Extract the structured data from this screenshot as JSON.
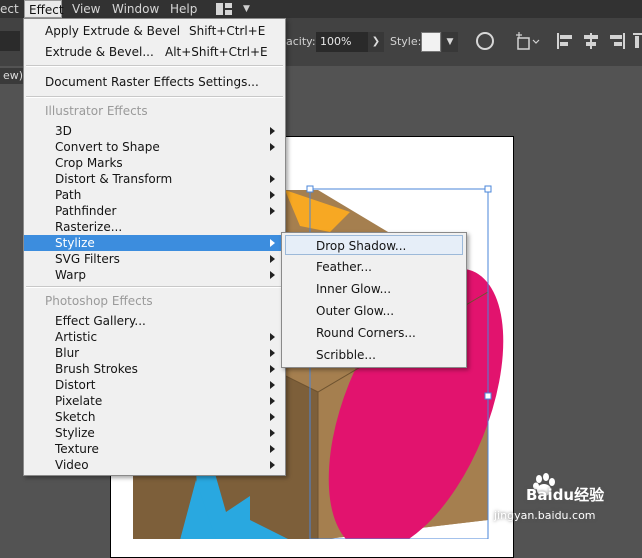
{
  "menubar": {
    "select_label": "ect",
    "effect_label": "Effect",
    "view_label": "View",
    "window_label": "Window",
    "help_label": "Help",
    "workspace_icon": "workspace-grid-icon"
  },
  "controlbar": {
    "opacity_label": "acity:",
    "opacity_value": "100%",
    "style_label": "Style:",
    "document_tab_label": "ew)"
  },
  "effect_menu": {
    "top_items": [
      {
        "label": "Apply Extrude & Bevel",
        "shortcut": "Shift+Ctrl+E"
      },
      {
        "label": "Extrude & Bevel...",
        "shortcut": "Alt+Shift+Ctrl+E"
      }
    ],
    "raster_settings": "Document Raster Effects Settings...",
    "illustrator_header": "Illustrator Effects",
    "illustrator_items": [
      {
        "label": "3D"
      },
      {
        "label": "Convert to Shape"
      },
      {
        "label": "Crop Marks"
      },
      {
        "label": "Distort & Transform"
      },
      {
        "label": "Path"
      },
      {
        "label": "Pathfinder"
      },
      {
        "label": "Rasterize..."
      },
      {
        "label": "Stylize"
      },
      {
        "label": "SVG Filters"
      },
      {
        "label": "Warp"
      }
    ],
    "photoshop_header": "Photoshop Effects",
    "photoshop_items": [
      {
        "label": "Effect Gallery..."
      },
      {
        "label": "Artistic"
      },
      {
        "label": "Blur"
      },
      {
        "label": "Brush Strokes"
      },
      {
        "label": "Distort"
      },
      {
        "label": "Pixelate"
      },
      {
        "label": "Sketch"
      },
      {
        "label": "Stylize"
      },
      {
        "label": "Texture"
      },
      {
        "label": "Video"
      }
    ]
  },
  "stylize_menu": {
    "items": [
      {
        "label": "Drop Shadow..."
      },
      {
        "label": "Feather..."
      },
      {
        "label": "Inner Glow..."
      },
      {
        "label": "Outer Glow..."
      },
      {
        "label": "Round Corners..."
      },
      {
        "label": "Scribble..."
      }
    ]
  },
  "watermark": {
    "brand": "Baidu",
    "brand_suffix": "经验",
    "url": "jingyan.baidu.com"
  },
  "colors": {
    "menubar_bg": "#323232",
    "control_bg": "#424242",
    "canvas_bg": "#535353",
    "menu_bg": "#f0f0f0",
    "highlight": "#3c8dde",
    "cube_light": "#a57f4f",
    "cube_dark": "#7d5f3a",
    "magenta": "#e2136e",
    "blue": "#29a8e0",
    "orange": "#f7a823",
    "selection": "#4a86d8"
  }
}
